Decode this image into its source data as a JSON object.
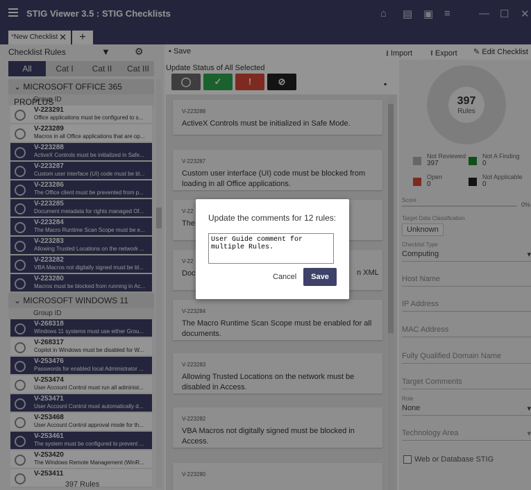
{
  "app": {
    "title": "STIG Viewer 3.5 : STIG Checklists"
  },
  "tabs": {
    "active": "New Checklist",
    "modified_marker": "*"
  },
  "left": {
    "header": "Checklist Rules",
    "cats": [
      "All",
      "Cat I",
      "Cat II",
      "Cat III"
    ],
    "group_id_label": "Group ID",
    "groups": [
      {
        "name": "MICROSOFT OFFICE 365 PROPLUS",
        "rules": [
          {
            "id": "V-223291",
            "desc": "Office applications must be configured to s...",
            "sel": false
          },
          {
            "id": "V-223289",
            "desc": "Macros in all Office applications that are op...",
            "sel": false
          },
          {
            "id": "V-223288",
            "desc": "ActiveX Controls must be initialized in Safe...",
            "sel": true
          },
          {
            "id": "V-223287",
            "desc": "Custom user interface (UI) code must be bl...",
            "sel": true
          },
          {
            "id": "V-223286",
            "desc": "The Office client must be prevented from p...",
            "sel": true
          },
          {
            "id": "V-223285",
            "desc": "Document metadata for rights managed Of...",
            "sel": true
          },
          {
            "id": "V-223284",
            "desc": "The Macro Runtime Scan Scope must be e...",
            "sel": true
          },
          {
            "id": "V-223283",
            "desc": "Allowing Trusted Locations on the network ...",
            "sel": true
          },
          {
            "id": "V-223282",
            "desc": "VBA Macros not digitally signed must be bl...",
            "sel": true
          },
          {
            "id": "V-223280",
            "desc": "Macros must be blocked from running in Ac...",
            "sel": true
          }
        ]
      },
      {
        "name": "MICROSOFT WINDOWS 11",
        "rules": [
          {
            "id": "V-268318",
            "desc": "Windows 11 systems must use either Grou...",
            "sel": true
          },
          {
            "id": "V-268317",
            "desc": "Copilot in Windows must be disabled for W...",
            "sel": false
          },
          {
            "id": "V-253476",
            "desc": "Passwords for enabled local Administrator ...",
            "sel": true
          },
          {
            "id": "V-253474",
            "desc": "User Account Control must run all administ...",
            "sel": false
          },
          {
            "id": "V-253471",
            "desc": "User Account Control must automatically d...",
            "sel": true
          },
          {
            "id": "V-253468",
            "desc": "User Account Control approval mode for th...",
            "sel": false
          },
          {
            "id": "V-253461",
            "desc": "The system must be configured to prevent ...",
            "sel": true
          },
          {
            "id": "V-253420",
            "desc": "The Windows Remote Management (WinR...",
            "sel": false
          },
          {
            "id": "V-253411",
            "desc": "",
            "sel": false
          }
        ]
      }
    ],
    "footer": "397 Rules"
  },
  "toolbar": {
    "save": "Save",
    "import": "Import",
    "export": "Export",
    "edit": "Edit Checklist"
  },
  "middle": {
    "update_label": "Update Status of All Selected",
    "status_colors": [
      "#6b6b6b",
      "#2fa84f",
      "#d9493a",
      "#222222"
    ],
    "cards": [
      {
        "id": "V-223288",
        "title": "ActiveX Controls must be initialized in Safe Mode."
      },
      {
        "id": "V-223287",
        "title": "Custom user interface (UI) code must be blocked from loading in all Office applications."
      },
      {
        "id": "V-22",
        "title": "The Shar"
      },
      {
        "id": "V-22",
        "title": "Doc files",
        "tail": "n XML"
      },
      {
        "id": "V-223284",
        "title": "The Macro Runtime Scan Scope must be enabled for all documents."
      },
      {
        "id": "V-223283",
        "title": "Allowing Trusted Locations on the network must be disabled in Access."
      },
      {
        "id": "V-223282",
        "title": "VBA Macros not digitally signed must be blocked in Access."
      },
      {
        "id": "V-223280",
        "title": ""
      }
    ]
  },
  "right": {
    "total": "397",
    "total_label": "Rules",
    "legend": [
      {
        "label": "Not Reviewed",
        "value": "397",
        "color": "#b0b0b0"
      },
      {
        "label": "Not A Finding",
        "value": "0",
        "color": "#1a8a2e"
      },
      {
        "label": "Open",
        "value": "0",
        "color": "#d9493a"
      },
      {
        "label": "Not Applicable",
        "value": "0",
        "color": "#222222"
      }
    ],
    "score_label": "Score",
    "score_value": "0%",
    "classification_label": "Target Data Classification",
    "classification": "Unknown",
    "type_label": "Checklist Type",
    "type": "Computing",
    "host": "Host Name",
    "ip": "IP Address",
    "mac": "MAC Address",
    "fqdn": "Fully Qualified Domain Name",
    "comments": "Target Comments",
    "role_label": "Role",
    "role": "None",
    "tech": "Technology Area",
    "web": "Web or Database STIG"
  },
  "dialog": {
    "title": "Update the comments for 12 rules:",
    "value": "User Guide comment for multiple Rules.",
    "cancel": "Cancel",
    "save": "Save"
  }
}
